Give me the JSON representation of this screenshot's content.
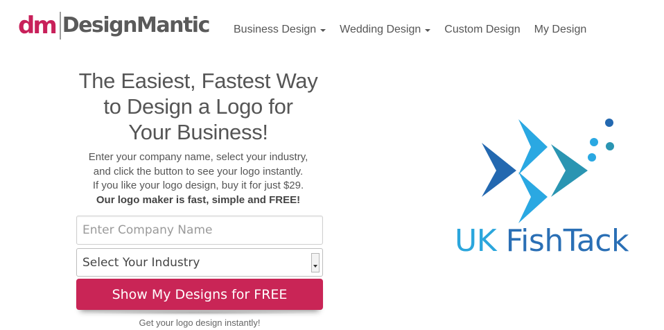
{
  "header": {
    "logo_mark": "dm",
    "logo_text": "DesignMantic",
    "nav": [
      {
        "label": "Business Design",
        "has_dropdown": true
      },
      {
        "label": "Wedding Design",
        "has_dropdown": true
      },
      {
        "label": "Custom Design",
        "has_dropdown": false
      },
      {
        "label": "My Design",
        "has_dropdown": false
      }
    ]
  },
  "hero": {
    "headline_lines": [
      "The Easiest, Fastest Way",
      "to Design a Logo for",
      "Your Business!"
    ],
    "desc_lines": [
      "Enter your company name, select your industry,",
      "and click the button to see your logo instantly.",
      "If you like your logo design, buy it for just $29."
    ],
    "desc_bold": "Our logo maker is fast, simple and FREE!"
  },
  "form": {
    "company_input": {
      "value": "",
      "placeholder": "Enter Company Name"
    },
    "industry_select": {
      "selected": "Select Your Industry"
    },
    "cta_label": "Show My Designs for FREE",
    "note": "Get your logo design instantly!"
  },
  "sample_logo": {
    "icon": "fish-logo-icon",
    "name_part1": "UK",
    "name_part2": "FishTack"
  },
  "colors": {
    "brand_pink": "#c92556",
    "logo_gray": "#5a5a5a",
    "fish_light_blue": "#2ba6dc",
    "fish_dark_blue": "#2a6fb5",
    "fish_teal": "#2a98b5"
  }
}
